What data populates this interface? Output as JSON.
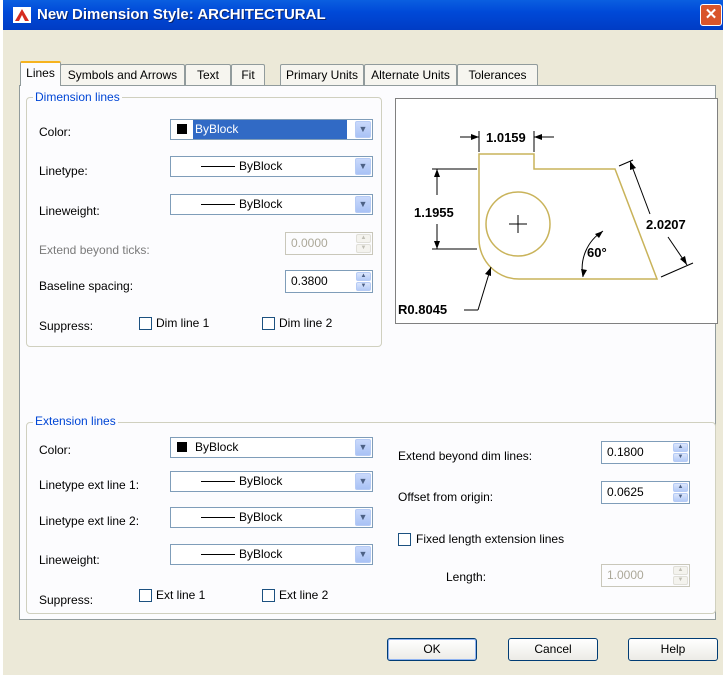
{
  "window": {
    "title": "New Dimension Style: ARCHITECTURAL"
  },
  "tabs": [
    "Lines",
    "Symbols and Arrows",
    "Text",
    "Fit",
    "Primary Units",
    "Alternate Units",
    "Tolerances"
  ],
  "dimension_lines": {
    "legend": "Dimension lines",
    "color_label": "Color:",
    "color_value": "ByBlock",
    "linetype_label": "Linetype:",
    "linetype_value": "ByBlock",
    "lineweight_label": "Lineweight:",
    "lineweight_value": "ByBlock",
    "extend_label": "Extend beyond ticks:",
    "extend_value": "0.0000",
    "baseline_label": "Baseline spacing:",
    "baseline_value": "0.3800",
    "suppress_label": "Suppress:",
    "dim_line_1": "Dim line 1",
    "dim_line_2": "Dim line 2"
  },
  "preview": {
    "dim_top": "1.0159",
    "dim_left": "1.1955",
    "dim_right": "2.0207",
    "angle": "60°",
    "radius": "R0.8045"
  },
  "extension_lines": {
    "legend": "Extension lines",
    "color_label": "Color:",
    "color_value": "ByBlock",
    "linetype1_label": "Linetype ext line 1:",
    "linetype1_value": "ByBlock",
    "linetype2_label": "Linetype ext line 2:",
    "linetype2_value": "ByBlock",
    "lineweight_label": "Lineweight:",
    "lineweight_value": "ByBlock",
    "suppress_label": "Suppress:",
    "ext_line_1": "Ext line 1",
    "ext_line_2": "Ext line 2",
    "extend_dim_label": "Extend beyond dim lines:",
    "extend_dim_value": "0.1800",
    "offset_label": "Offset from origin:",
    "offset_value": "0.0625",
    "fixed_length_label": "Fixed length extension lines",
    "length_label": "Length:",
    "length_value": "1.0000"
  },
  "buttons": {
    "ok": "OK",
    "cancel": "Cancel",
    "help": "Help"
  },
  "colors": {
    "titlebar": "#0049d8",
    "legend": "#0046d5",
    "dialog_bg": "#ece9d8",
    "close": "#d9552b"
  }
}
